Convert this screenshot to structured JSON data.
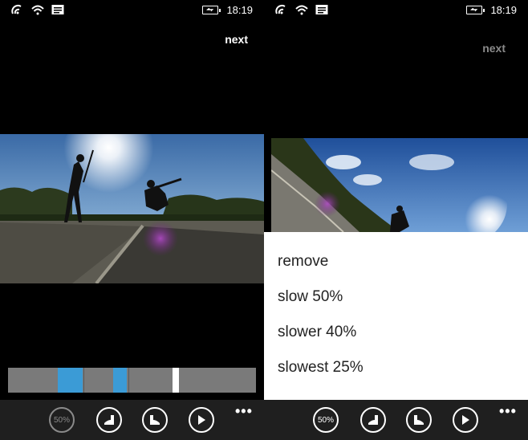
{
  "status": {
    "time": "18:19"
  },
  "left": {
    "next_label": "next"
  },
  "right": {
    "next_label": "next"
  },
  "appbar": {
    "speed_label": "50%",
    "more": "•••"
  },
  "timeline": {
    "accent": "#3b9bd6"
  },
  "menu": {
    "items": [
      {
        "label": "remove"
      },
      {
        "label": "slow 50%"
      },
      {
        "label": "slower 40%"
      },
      {
        "label": "slowest 25%"
      }
    ]
  }
}
